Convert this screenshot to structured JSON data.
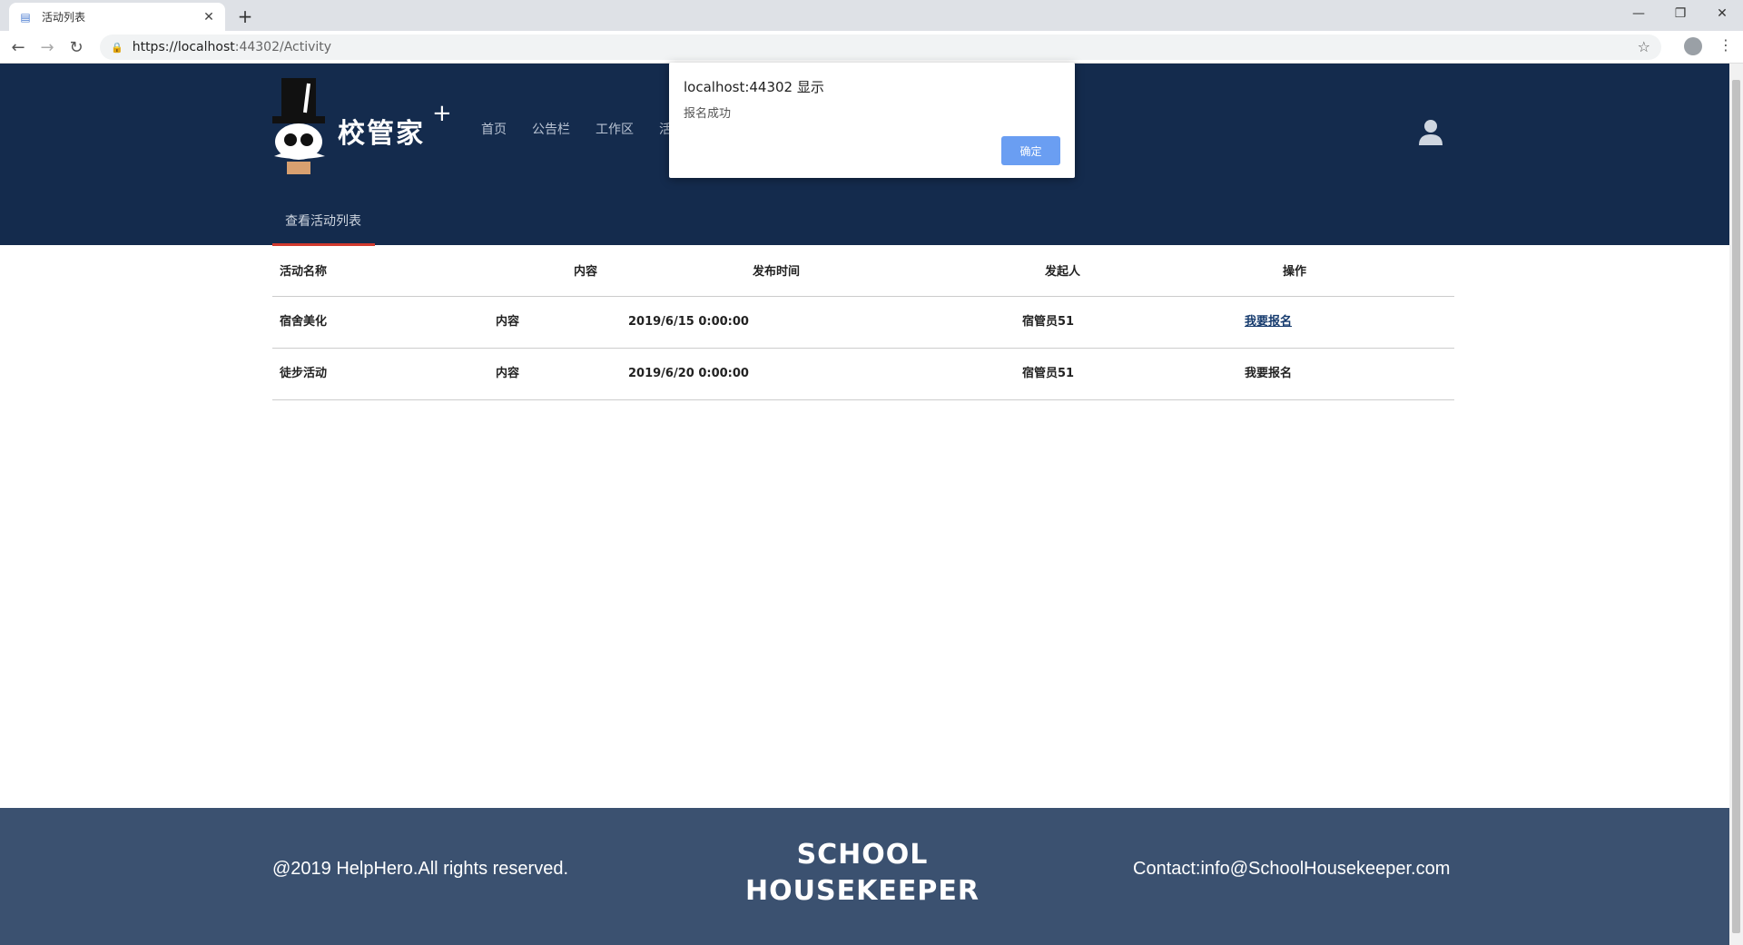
{
  "browser": {
    "tab_title": "活动列表",
    "url_scheme": "https://localhost",
    "url_rest": ":44302/Activity"
  },
  "site": {
    "logo_text": "校管家",
    "logo_plus": "+",
    "nav": [
      "首页",
      "公告栏",
      "工作区",
      "活"
    ],
    "subnav_label": "查看活动列表"
  },
  "table": {
    "headers": [
      "活动名称",
      "内容",
      "发布时间",
      "发起人",
      "操作"
    ],
    "rows": [
      {
        "name": "宿舍美化",
        "content": "内容",
        "time": "2019/6/15 0:00:00",
        "sponsor": "宿管员51",
        "action": "我要报名"
      },
      {
        "name": "徒步活动",
        "content": "内容",
        "time": "2019/6/20 0:00:00",
        "sponsor": "宿管员51",
        "action": "我要报名"
      }
    ]
  },
  "footer": {
    "copyright": "@2019 HelpHero.All rights reserved.",
    "brand_line1": "SCHOOL",
    "brand_line2": "HOUSEKEEPER",
    "contact": "Contact:info@SchoolHousekeeper.com"
  },
  "alert": {
    "title": "localhost:44302 显示",
    "message": "报名成功",
    "ok_label": "确定"
  },
  "colors": {
    "header_bg": "#142b4d",
    "footer_bg": "#3b5170",
    "accent_underline": "#d23a2e",
    "link": "#1b5e9e",
    "alert_button": "#6a9ef2"
  }
}
